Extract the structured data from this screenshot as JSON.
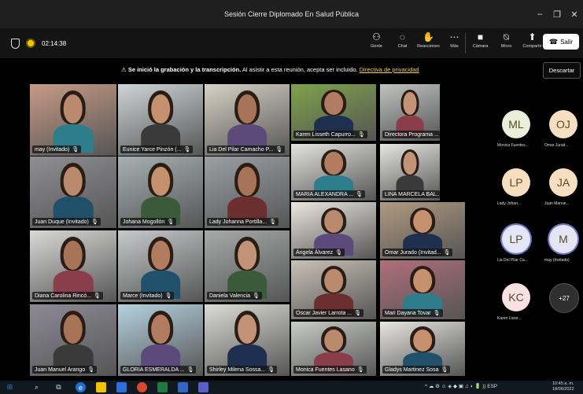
{
  "window": {
    "title": "Sesión Cierre Diplomado En Salud Pública",
    "controls": [
      "–",
      "❐",
      "✕"
    ]
  },
  "toolbar": {
    "timer": "02:14:38",
    "tools": [
      {
        "label": "Gente",
        "icon": "people-icon"
      },
      {
        "label": "Chat",
        "icon": "chat-icon"
      },
      {
        "label": "Reacciones",
        "icon": "reactions-icon"
      },
      {
        "label": "Más",
        "icon": "more-icon"
      }
    ],
    "media": [
      {
        "label": "Cámara",
        "icon": "camera-icon"
      },
      {
        "label": "Micro",
        "icon": "mic-muted-icon"
      },
      {
        "label": "Compartir",
        "icon": "share-icon"
      }
    ],
    "leave_label": "Salir"
  },
  "banner": {
    "bold_text": "Se inició la grabación y la transcripción.",
    "text": "Al asistir a esta reunión, acepta ser incluido.",
    "link": "Directiva de privacidad",
    "dismiss_label": "Descartar"
  },
  "tiles": [
    {
      "name": "may (Invitado)"
    },
    {
      "name": "Eunice Yarce Pinzón (..."
    },
    {
      "name": "Lia Del Pilar Camacho P..."
    },
    {
      "name": "Karen Lisseth Capurro..."
    },
    {
      "name": "Directora Programa ..."
    },
    {
      "name": "Juan  Duque (Invitado)"
    },
    {
      "name": "Johana Mogollón"
    },
    {
      "name": "Lady Johanna Portilla..."
    },
    {
      "name": "MARIA ALEXANDRA ..."
    },
    {
      "name": "LINA MARCELA BAL..."
    },
    {
      "name": "Ángela Álvarez"
    },
    {
      "name": "Omar Jurado (Invitad..."
    },
    {
      "name": "Diana Carolina Rincó..."
    },
    {
      "name": "Marce (Invitado)"
    },
    {
      "name": "Daniela Valencia"
    },
    {
      "name": "Oscar Javier Larrota ..."
    },
    {
      "name": "Mari Dayana Tovar"
    },
    {
      "name": "Juan Manuel Arango"
    },
    {
      "name": "GLORIA ESMERALDA ..."
    },
    {
      "name": "Shirley Milena Sossa..."
    },
    {
      "name": "Monica Fuentes Lasano"
    },
    {
      "name": "Gladys Martinez Sosa"
    }
  ],
  "participants": [
    {
      "initials": "ML",
      "label": "Monica Fuentes...",
      "color": "#e9efd8"
    },
    {
      "initials": "OJ",
      "label": "Omar Jurad...",
      "color": "#f6dfc0"
    },
    {
      "initials": "LP",
      "label": "Lady Johan...",
      "color": "#f6dfc0"
    },
    {
      "initials": "JA",
      "label": "Juan Manue...",
      "color": "#f6dfc0"
    },
    {
      "initials": "LP",
      "label": "Lia Del Pilar Ca...",
      "color": "#e4e6f6"
    },
    {
      "initials": "M",
      "label": "may (Invitado)",
      "color": "#e4e6f6"
    },
    {
      "initials": "KC",
      "label": "Karen Lisse...",
      "color": "#f8e0e3"
    }
  ],
  "overflow_count": "+27",
  "taskbar": {
    "time": "10:45 a. m.",
    "date": "18/06/2022",
    "lang": "ESP"
  }
}
